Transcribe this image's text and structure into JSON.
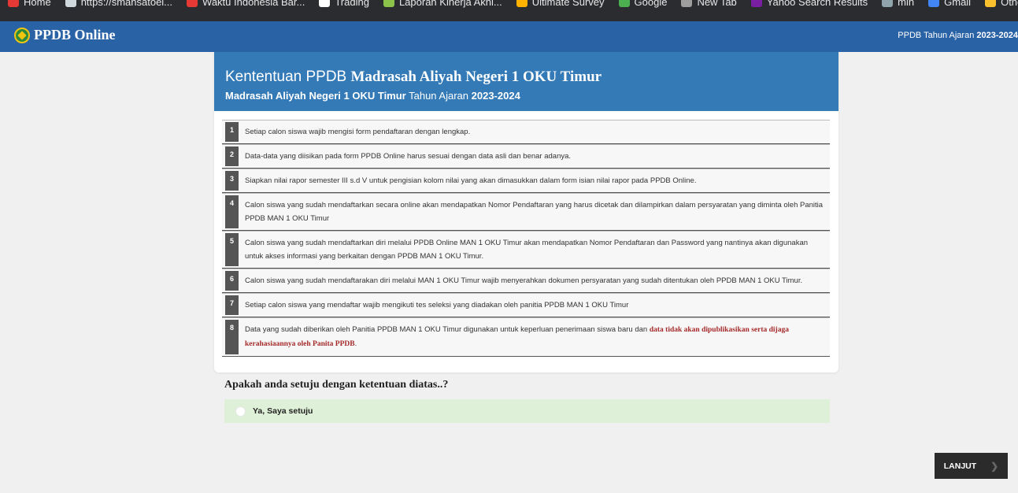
{
  "bookmarks": [
    {
      "label": "Home",
      "color": "#e53935"
    },
    {
      "label": "https://smansatoel...",
      "color": "#cfd8dc"
    },
    {
      "label": "Waktu Indonesia Bar...",
      "color": "#e53935"
    },
    {
      "label": "Trading",
      "color": "#ffffff"
    },
    {
      "label": "Laporan Kinerja Akhi...",
      "color": "#8bc34a"
    },
    {
      "label": "Ultimate Survey",
      "color": "#ffb300"
    },
    {
      "label": "Google",
      "color": "#4caf50"
    },
    {
      "label": "New Tab",
      "color": "#9e9e9e"
    },
    {
      "label": "Yahoo Search Results",
      "color": "#7b1fa2"
    },
    {
      "label": "mln",
      "color": "#90a4ae"
    },
    {
      "label": "Gmail",
      "color": "#4285f4"
    },
    {
      "label": "Other bookmarks",
      "color": "#fbc02d"
    }
  ],
  "navbar": {
    "brand": "PPDB Online",
    "right_prefix": "PPDB Tahun Ajaran ",
    "right_year": "2023-2024"
  },
  "card": {
    "title_prefix": "Kententuan PPDB ",
    "title_school": "Madrasah Aliyah Negeri 1 OKU Timur",
    "sub_school": "Madrasah Aliyah Negeri 1 OKU Timur",
    "sub_middle": " Tahun Ajaran ",
    "sub_year": "2023-2024"
  },
  "rules": [
    {
      "num": "1",
      "text": "Setiap calon siswa wajib mengisi form pendaftaran dengan lengkap."
    },
    {
      "num": "2",
      "text": "Data-data yang diisikan pada form PPDB Online harus sesuai dengan data asli dan benar adanya."
    },
    {
      "num": "3",
      "text": "Siapkan nilai rapor semester III s.d V untuk pengisian kolom nilai yang akan dimasukkan dalam form isian nilai rapor pada PPDB Online."
    },
    {
      "num": "4",
      "text": "Calon siswa yang sudah mendaftarkan secara online akan mendapatkan Nomor Pendaftaran yang harus dicetak dan dilampirkan dalam persyaratan yang diminta oleh Panitia PPDB MAN 1 OKU Timur"
    },
    {
      "num": "5",
      "text": "Calon siswa yang sudah mendaftarkan diri melalui PPDB Online MAN 1 OKU Timur akan mendapatkan Nomor Pendaftaran dan Password yang nantinya akan digunakan untuk akses informasi yang berkaitan dengan PPDB MAN 1 OKU Timur."
    },
    {
      "num": "6",
      "text": "Calon siswa yang sudah mendaftarakan diri melalui MAN 1 OKU Timur wajib menyerahkan dokumen persyaratan yang sudah ditentukan oleh PPDB MAN 1 OKU Timur."
    },
    {
      "num": "7",
      "text": "Setiap calon siswa yang mendaftar wajib mengikuti tes seleksi yang diadakan oleh panitia PPDB MAN 1 OKU Timur"
    },
    {
      "num": "8",
      "text": "Data yang sudah diberikan oleh Panitia PPDB MAN 1 OKU Timur digunakan untuk keperluan penerimaan siswa baru dan ",
      "warn": "data tidak akan dipublikasikan serta dijaga kerahasiaannya oleh Panita PPDB",
      "tail": "."
    }
  ],
  "question": "Apakah anda setuju dengan ketentuan diatas..?",
  "agree_label": "Ya, Saya setuju",
  "next_button": "LANJUT",
  "colors": {
    "navbar": "#2a62a6",
    "card_header": "#337ab7",
    "agree_bg": "#dff0d8",
    "warn_text": "#a52a2a"
  }
}
